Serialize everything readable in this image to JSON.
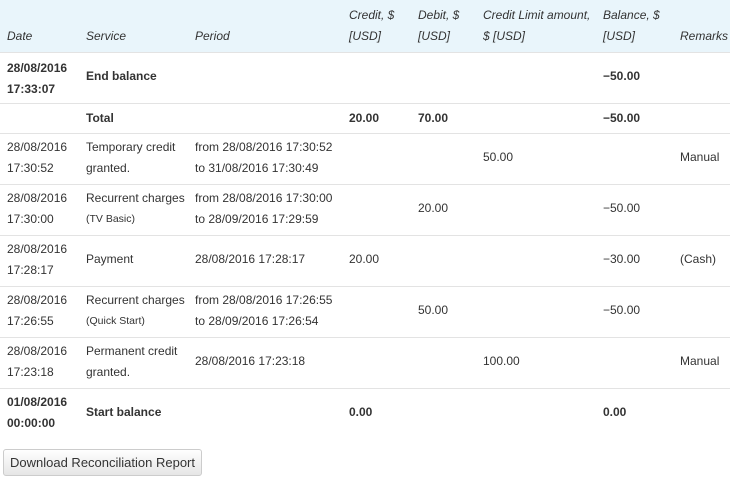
{
  "table": {
    "headers": {
      "date": "Date",
      "service": "Service",
      "period": "Period",
      "credit_l1": "Credit, $",
      "credit_l2": "[USD]",
      "debit_l1": "Debit, $",
      "debit_l2": "[USD]",
      "credit_limit_l1": "Credit Limit amount,",
      "credit_limit_l2": "$ [USD]",
      "balance_l1": "Balance, $",
      "balance_l2": "[USD]",
      "remarks": "Remarks"
    },
    "rows": [
      {
        "date1": "28/08/2016",
        "date2": "17:33:07",
        "service1": "End balance",
        "service2": "",
        "period1": "",
        "period2": "",
        "credit": "",
        "debit": "",
        "credit_limit": "",
        "balance": "−50.00",
        "remarks": ""
      },
      {
        "date1": "",
        "date2": "",
        "service1": "Total",
        "service2": "",
        "period1": "",
        "period2": "",
        "credit": "20.00",
        "debit": "70.00",
        "credit_limit": "",
        "balance": "−50.00",
        "remarks": ""
      },
      {
        "date1": "28/08/2016",
        "date2": "17:30:52",
        "service1": "Temporary credit",
        "service2": "granted.",
        "period1": "from 28/08/2016 17:30:52",
        "period2": "to 31/08/2016 17:30:49",
        "credit": "",
        "debit": "",
        "credit_limit": "50.00",
        "balance": "",
        "remarks": "Manual"
      },
      {
        "date1": "28/08/2016",
        "date2": "17:30:00",
        "service1": "Recurrent charges",
        "service2": "(TV Basic)",
        "period1": "from 28/08/2016 17:30:00",
        "period2": "to 28/09/2016 17:29:59",
        "credit": "",
        "debit": "20.00",
        "credit_limit": "",
        "balance": "−50.00",
        "remarks": ""
      },
      {
        "date1": "28/08/2016",
        "date2": "17:28:17",
        "service1": "Payment",
        "service2": "",
        "period1": "28/08/2016 17:28:17",
        "period2": "",
        "credit": "20.00",
        "debit": "",
        "credit_limit": "",
        "balance": "−30.00",
        "remarks": "(Cash)"
      },
      {
        "date1": "28/08/2016",
        "date2": "17:26:55",
        "service1": "Recurrent charges",
        "service2": "(Quick Start)",
        "period1": "from 28/08/2016 17:26:55",
        "period2": "to 28/09/2016 17:26:54",
        "credit": "",
        "debit": "50.00",
        "credit_limit": "",
        "balance": "−50.00",
        "remarks": ""
      },
      {
        "date1": "28/08/2016",
        "date2": "17:23:18",
        "service1": "Permanent credit",
        "service2": "granted.",
        "period1": "28/08/2016 17:23:18",
        "period2": "",
        "credit": "",
        "debit": "",
        "credit_limit": "100.00",
        "balance": "",
        "remarks": "Manual"
      },
      {
        "date1": "01/08/2016",
        "date2": "00:00:00",
        "service1": "Start balance",
        "service2": "",
        "period1": "",
        "period2": "",
        "credit": "0.00",
        "debit": "",
        "credit_limit": "",
        "balance": "0.00",
        "remarks": ""
      }
    ]
  },
  "download_button": {
    "label": "Download Reconciliation Report"
  }
}
